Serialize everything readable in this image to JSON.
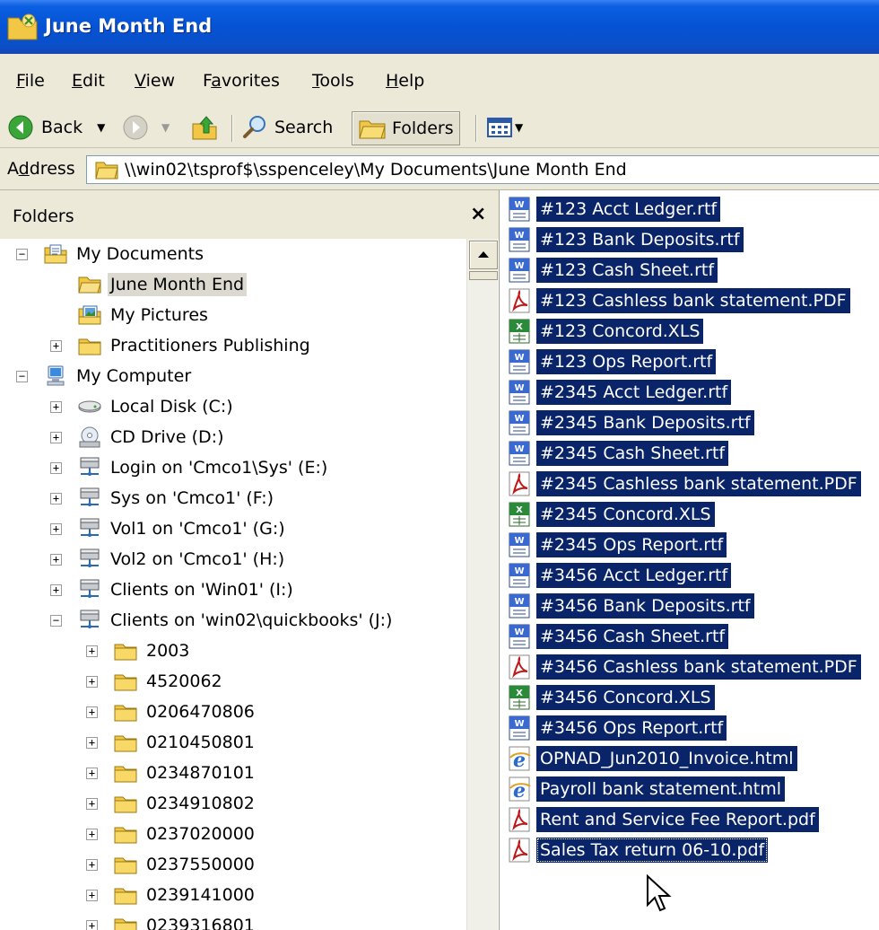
{
  "window": {
    "title": "June Month End"
  },
  "menu": [
    {
      "key": "F",
      "rest": "ile"
    },
    {
      "key": "E",
      "rest": "dit"
    },
    {
      "key": "V",
      "rest": "iew"
    },
    {
      "pre": "F",
      "key": "a",
      "rest": "vorites"
    },
    {
      "key": "T",
      "rest": "ools"
    },
    {
      "key": "H",
      "rest": "elp"
    }
  ],
  "toolbar": {
    "back": "Back",
    "search": "Search",
    "folders": "Folders"
  },
  "address": {
    "label_pre": "A",
    "label_key": "d",
    "label_rest": "dress",
    "path": "\\\\win02\\tsprof$\\sspenceley\\My Documents\\June Month End"
  },
  "folders_pane": {
    "title": "Folders",
    "close": "×"
  },
  "tree": [
    {
      "label": "My Documents",
      "indent": 0,
      "exp": "minus",
      "icon": "mydocs"
    },
    {
      "label": "June Month End",
      "indent": 1,
      "exp": "none",
      "icon": "folder-open",
      "selected": true
    },
    {
      "label": "My Pictures",
      "indent": 1,
      "exp": "none",
      "icon": "pictures"
    },
    {
      "label": "Practitioners Publishing",
      "indent": 1,
      "exp": "plus",
      "icon": "folder"
    },
    {
      "label": "My Computer",
      "indent": 0,
      "exp": "minus",
      "icon": "computer"
    },
    {
      "label": "Local Disk (C:)",
      "indent": 1,
      "exp": "plus",
      "icon": "disk"
    },
    {
      "label": "CD Drive (D:)",
      "indent": 1,
      "exp": "plus",
      "icon": "cd"
    },
    {
      "label": "Login on 'Cmco1\\Sys' (E:)",
      "indent": 1,
      "exp": "plus",
      "icon": "netdrive"
    },
    {
      "label": "Sys on 'Cmco1' (F:)",
      "indent": 1,
      "exp": "plus",
      "icon": "netdrive"
    },
    {
      "label": "Vol1 on 'Cmco1' (G:)",
      "indent": 1,
      "exp": "plus",
      "icon": "netdrive"
    },
    {
      "label": "Vol2 on 'Cmco1' (H:)",
      "indent": 1,
      "exp": "plus",
      "icon": "netdrive"
    },
    {
      "label": "Clients on 'Win01' (I:)",
      "indent": 1,
      "exp": "plus",
      "icon": "netdrive"
    },
    {
      "label": "Clients on 'win02\\quickbooks' (J:)",
      "indent": 1,
      "exp": "minus",
      "icon": "netdrive"
    },
    {
      "label": "2003",
      "indent": 2,
      "exp": "plus",
      "icon": "folder"
    },
    {
      "label": "4520062",
      "indent": 2,
      "exp": "plus",
      "icon": "folder"
    },
    {
      "label": "0206470806",
      "indent": 2,
      "exp": "plus",
      "icon": "folder"
    },
    {
      "label": "0210450801",
      "indent": 2,
      "exp": "plus",
      "icon": "folder"
    },
    {
      "label": "0234870101",
      "indent": 2,
      "exp": "plus",
      "icon": "folder"
    },
    {
      "label": "0234910802",
      "indent": 2,
      "exp": "plus",
      "icon": "folder"
    },
    {
      "label": "0237020000",
      "indent": 2,
      "exp": "plus",
      "icon": "folder"
    },
    {
      "label": "0237550000",
      "indent": 2,
      "exp": "plus",
      "icon": "folder"
    },
    {
      "label": "0239141000",
      "indent": 2,
      "exp": "plus",
      "icon": "folder"
    },
    {
      "label": "0239316801",
      "indent": 2,
      "exp": "plus",
      "icon": "folder"
    }
  ],
  "files": [
    {
      "name": "#123 Acct Ledger.rtf",
      "type": "word"
    },
    {
      "name": "#123 Bank Deposits.rtf",
      "type": "word"
    },
    {
      "name": "#123 Cash Sheet.rtf",
      "type": "word"
    },
    {
      "name": "#123 Cashless bank statement.PDF",
      "type": "pdf"
    },
    {
      "name": "#123 Concord.XLS",
      "type": "excel"
    },
    {
      "name": "#123 Ops Report.rtf",
      "type": "word"
    },
    {
      "name": "#2345 Acct Ledger.rtf",
      "type": "word"
    },
    {
      "name": "#2345 Bank Deposits.rtf",
      "type": "word"
    },
    {
      "name": "#2345 Cash Sheet.rtf",
      "type": "word"
    },
    {
      "name": "#2345 Cashless bank statement.PDF",
      "type": "pdf"
    },
    {
      "name": "#2345 Concord.XLS",
      "type": "excel"
    },
    {
      "name": "#2345 Ops Report.rtf",
      "type": "word"
    },
    {
      "name": "#3456 Acct Ledger.rtf",
      "type": "word"
    },
    {
      "name": "#3456 Bank Deposits.rtf",
      "type": "word"
    },
    {
      "name": "#3456 Cash Sheet.rtf",
      "type": "word"
    },
    {
      "name": "#3456 Cashless bank statement.PDF",
      "type": "pdf"
    },
    {
      "name": "#3456 Concord.XLS",
      "type": "excel"
    },
    {
      "name": "#3456 Ops Report.rtf",
      "type": "word"
    },
    {
      "name": "OPNAD_Jun2010_Invoice.html",
      "type": "ie"
    },
    {
      "name": "Payroll bank statement.html",
      "type": "ie"
    },
    {
      "name": "Rent and Service Fee Report.pdf",
      "type": "pdf"
    },
    {
      "name": "Sales Tax return 06-10.pdf",
      "type": "pdf",
      "focused": true
    }
  ],
  "colors": {
    "selection": "#0a246a",
    "titlebar": "#0553d4",
    "chrome": "#ece9d8"
  }
}
